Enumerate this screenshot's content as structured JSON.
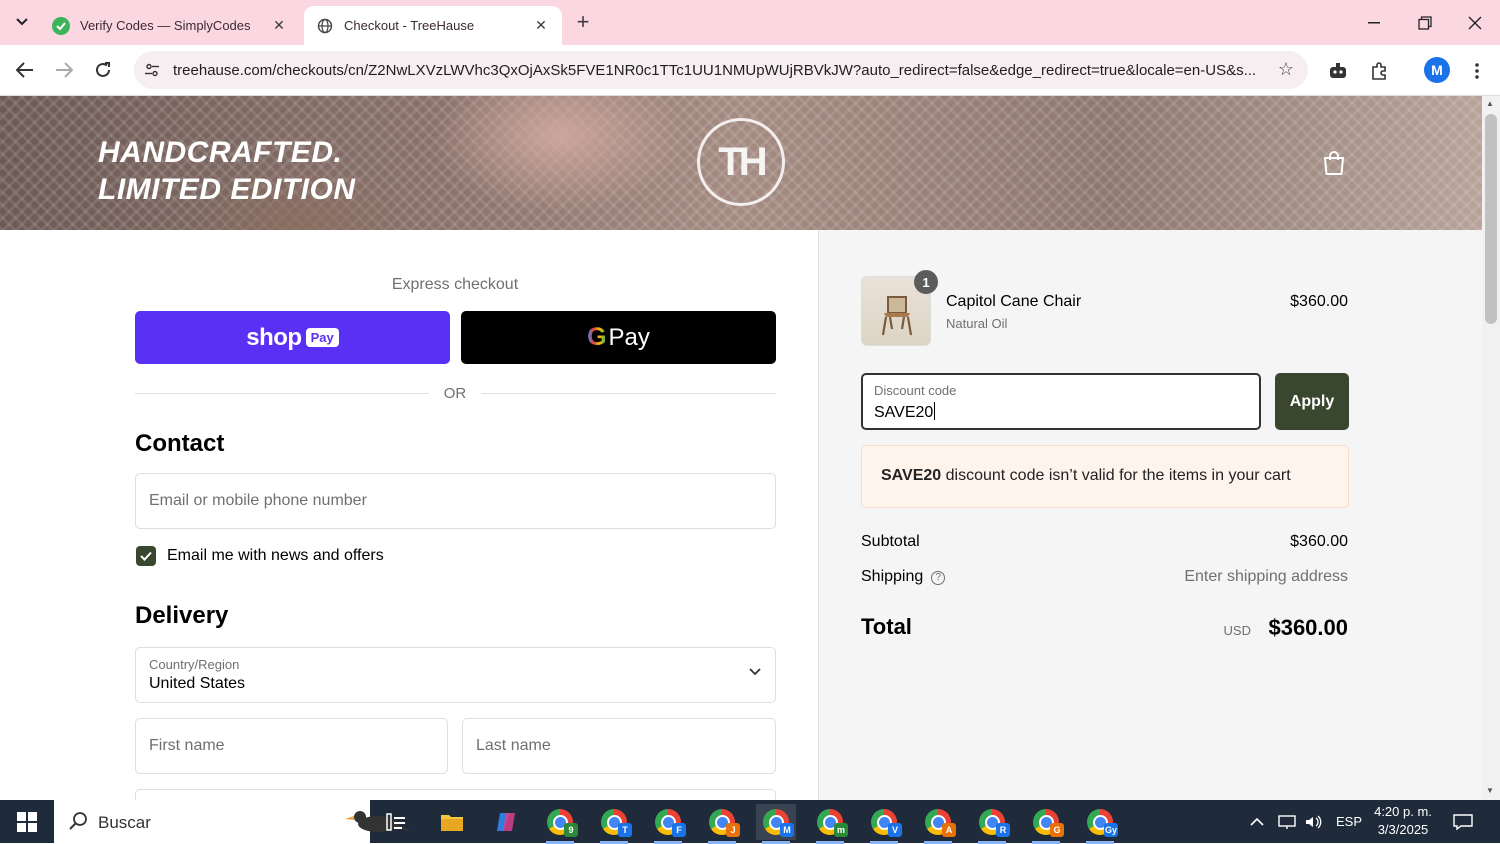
{
  "browser": {
    "tabs": [
      {
        "title": "Verify Codes — SimplyCodes",
        "active": false
      },
      {
        "title": "Checkout - TreeHause",
        "active": true
      }
    ],
    "url": "treehause.com/checkouts/cn/Z2NwLXVzLWVhc3QxOjAxSk5FVE1NR0c1TTc1UU1NMUpWUjRBVkJW?auto_redirect=false&edge_redirect=true&locale=en-US&s...",
    "profile_initial": "M",
    "colors": {
      "tabbar": "#fbd7e2",
      "omnibox": "#f6eef1"
    }
  },
  "hero": {
    "slogan_line1": "HANDCRAFTED.",
    "slogan_line2": "LIMITED EDITION",
    "logo_text": "TH"
  },
  "checkout": {
    "express_label": "Express checkout",
    "shop_pay": {
      "word": "shop",
      "pay": "Pay"
    },
    "gpay": {
      "g": "G",
      "pay": "Pay"
    },
    "or_text": "OR",
    "contact": {
      "title": "Contact",
      "email_placeholder": "Email or mobile phone number",
      "newsletter_label": "Email me with news and offers",
      "newsletter_checked": true
    },
    "delivery": {
      "title": "Delivery",
      "country_label": "Country/Region",
      "country_value": "United States",
      "first_name_placeholder": "First name",
      "last_name_placeholder": "Last name"
    }
  },
  "summary": {
    "item": {
      "quantity": "1",
      "name": "Capitol Cane Chair",
      "variant": "Natural Oil",
      "price": "$360.00"
    },
    "discount": {
      "label": "Discount code",
      "value": "SAVE20",
      "apply_label": "Apply"
    },
    "error": {
      "code": "SAVE20",
      "message": "discount code isn’t valid for the items in your cart"
    },
    "subtotal_label": "Subtotal",
    "subtotal_value": "$360.00",
    "shipping_label": "Shipping",
    "shipping_value": "Enter shipping address",
    "total_label": "Total",
    "total_currency": "USD",
    "total_value": "$360.00",
    "colors": {
      "accent": "#39472f",
      "shop_pay": "#5a31f4",
      "alert_bg": "#fff4ec"
    }
  },
  "taskbar": {
    "search_text": "Buscar",
    "apps": [
      {
        "name": "chrome-9",
        "badge": "9",
        "badge_color": "#2a8a3a"
      },
      {
        "name": "chrome-T",
        "badge": "T",
        "badge_color": "#1a73e8"
      },
      {
        "name": "chrome-F",
        "badge": "F",
        "badge_color": "#1a73e8"
      },
      {
        "name": "chrome-J",
        "badge": "J",
        "badge_color": "#e8710a"
      },
      {
        "name": "chrome-M",
        "badge": "M",
        "badge_color": "#1a73e8"
      },
      {
        "name": "chrome-m",
        "badge": "m",
        "badge_color": "#2a8a3a"
      },
      {
        "name": "chrome-V",
        "badge": "V",
        "badge_color": "#1a73e8"
      },
      {
        "name": "chrome-A",
        "badge": "A",
        "badge_color": "#e8710a"
      },
      {
        "name": "chrome-R",
        "badge": "R",
        "badge_color": "#1a73e8"
      },
      {
        "name": "chrome-G",
        "badge": "G",
        "badge_color": "#e8710a"
      },
      {
        "name": "chrome-Gy",
        "badge": "Gy",
        "badge_color": "#1a73e8"
      }
    ],
    "language": "ESP",
    "time": "4:20 p. m.",
    "date": "3/3/2025"
  }
}
